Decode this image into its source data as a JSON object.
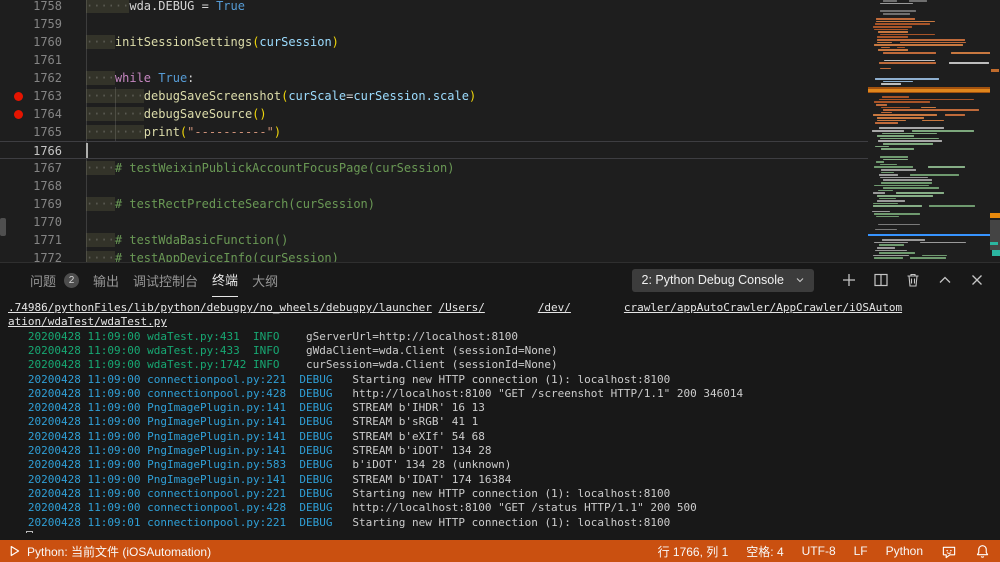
{
  "colors": {
    "statusbar_bg": "#CA5010",
    "breakpoint": "#E51400",
    "terminal_info": "#17A873",
    "terminal_debug": "#2F9FD6",
    "minimap_highlight": "#E0861C"
  },
  "editor": {
    "lines": [
      {
        "num": "1758",
        "tokens": [
          {
            "t": "······",
            "c": "ws"
          },
          {
            "t": "wda.DEBUG ",
            "c": "pl"
          },
          {
            "t": "= ",
            "c": "pl"
          },
          {
            "t": "True",
            "c": "kc"
          }
        ]
      },
      {
        "num": "1759",
        "tokens": []
      },
      {
        "num": "1760",
        "tokens": [
          {
            "t": "····",
            "c": "ws"
          },
          {
            "t": "initSessionSettings",
            "c": "fn"
          },
          {
            "t": "(",
            "c": "br"
          },
          {
            "t": "curSession",
            "c": "vr"
          },
          {
            "t": ")",
            "c": "br"
          }
        ]
      },
      {
        "num": "1761",
        "tokens": []
      },
      {
        "num": "1762",
        "tokens": [
          {
            "t": "····",
            "c": "ws"
          },
          {
            "t": "while ",
            "c": "kw"
          },
          {
            "t": "True",
            "c": "kc"
          },
          {
            "t": ":",
            "c": "pl"
          }
        ]
      },
      {
        "num": "1763",
        "bp": true,
        "g2": true,
        "tokens": [
          {
            "t": "········",
            "c": "ws"
          },
          {
            "t": "debugSaveScreenshot",
            "c": "fn"
          },
          {
            "t": "(",
            "c": "br"
          },
          {
            "t": "curScale",
            "c": "vr"
          },
          {
            "t": "=",
            "c": "pl"
          },
          {
            "t": "curSession.scale",
            "c": "vr"
          },
          {
            "t": ")",
            "c": "br"
          }
        ]
      },
      {
        "num": "1764",
        "bp": true,
        "g2": true,
        "tokens": [
          {
            "t": "········",
            "c": "ws"
          },
          {
            "t": "debugSaveSource",
            "c": "fn"
          },
          {
            "t": "()",
            "c": "br"
          }
        ]
      },
      {
        "num": "1765",
        "g2": true,
        "tokens": [
          {
            "t": "········",
            "c": "ws"
          },
          {
            "t": "print",
            "c": "fn"
          },
          {
            "t": "(",
            "c": "br"
          },
          {
            "t": "\"----------\"",
            "c": "st"
          },
          {
            "t": ")",
            "c": "br"
          }
        ]
      },
      {
        "num": "1766",
        "cur": true,
        "tokens": []
      },
      {
        "num": "1767",
        "tokens": [
          {
            "t": "····",
            "c": "ws"
          },
          {
            "t": "# testWeixinPublickAccountFocusPage(curSession)",
            "c": "cm"
          }
        ]
      },
      {
        "num": "1768",
        "tokens": []
      },
      {
        "num": "1769",
        "tokens": [
          {
            "t": "····",
            "c": "ws"
          },
          {
            "t": "# testRectPredicteSearch(curSession)",
            "c": "cm"
          }
        ]
      },
      {
        "num": "1770",
        "tokens": []
      },
      {
        "num": "1771",
        "tokens": [
          {
            "t": "····",
            "c": "ws"
          },
          {
            "t": "# testWdaBasicFunction()",
            "c": "cm"
          }
        ]
      },
      {
        "num": "1772",
        "tokens": [
          {
            "t": "····",
            "c": "ws"
          },
          {
            "t": "# testAppDeviceInfo(curSession)",
            "c": "cm"
          }
        ]
      }
    ]
  },
  "panel": {
    "tabs": [
      {
        "name": "problems",
        "label": "问题",
        "badge": "2"
      },
      {
        "name": "output",
        "label": "输出"
      },
      {
        "name": "debug-console",
        "label": "调试控制台"
      },
      {
        "name": "terminal",
        "label": "终端",
        "active": true
      },
      {
        "name": "outline",
        "label": "大纲"
      }
    ],
    "dropdown_value": "2: Python Debug Console"
  },
  "terminal": {
    "lines": [
      {
        "segs": [
          {
            "t": ".74986/pythonFiles/lib/python/debugpy/no_wheels/debugpy/launcher",
            "c": "lk"
          },
          {
            "t": " ",
            "c": "pl"
          },
          {
            "t": "/Users/",
            "c": "lk"
          },
          {
            "t": "        ",
            "c": "gap"
          },
          {
            "t": "/dev/",
            "c": "lk"
          },
          {
            "t": "        ",
            "c": "gap"
          },
          {
            "t": "crawler/appAutoCrawler/AppCrawler/iOSAutom",
            "c": "lk"
          }
        ]
      },
      {
        "segs": [
          {
            "t": "ation/wdaTest/wdaTest.py",
            "c": "lk"
          }
        ]
      },
      {
        "segs": [
          {
            "t": "   20200428 11:09:00 wdaTest.py:431  INFO",
            "c": "inf"
          },
          {
            "t": "    gServerUrl=http://localhost:8100",
            "c": "pl"
          }
        ]
      },
      {
        "segs": [
          {
            "t": "   20200428 11:09:00 wdaTest.py:433  INFO",
            "c": "inf"
          },
          {
            "t": "    gWdaClient=wda.Client (sessionId=None)",
            "c": "pl"
          }
        ]
      },
      {
        "segs": [
          {
            "t": "   20200428 11:09:00 wdaTest.py:1742 INFO",
            "c": "inf"
          },
          {
            "t": "    curSession=wda.Client (sessionId=None)",
            "c": "pl"
          }
        ]
      },
      {
        "segs": [
          {
            "t": "   20200428 11:09:00 connectionpool.py:221  DEBUG",
            "c": "dbg"
          },
          {
            "t": "   Starting new HTTP connection (1): localhost:8100",
            "c": "pl"
          }
        ]
      },
      {
        "segs": [
          {
            "t": "   20200428 11:09:00 connectionpool.py:428  DEBUG",
            "c": "dbg"
          },
          {
            "t": "   http://localhost:8100 \"GET /screenshot HTTP/1.1\" 200 346014",
            "c": "pl"
          }
        ]
      },
      {
        "segs": [
          {
            "t": "   20200428 11:09:00 PngImagePlugin.py:141  DEBUG",
            "c": "dbg"
          },
          {
            "t": "   STREAM b'IHDR' 16 13",
            "c": "pl"
          }
        ]
      },
      {
        "segs": [
          {
            "t": "   20200428 11:09:00 PngImagePlugin.py:141  DEBUG",
            "c": "dbg"
          },
          {
            "t": "   STREAM b'sRGB' 41 1",
            "c": "pl"
          }
        ]
      },
      {
        "segs": [
          {
            "t": "   20200428 11:09:00 PngImagePlugin.py:141  DEBUG",
            "c": "dbg"
          },
          {
            "t": "   STREAM b'eXIf' 54 68",
            "c": "pl"
          }
        ]
      },
      {
        "segs": [
          {
            "t": "   20200428 11:09:00 PngImagePlugin.py:141  DEBUG",
            "c": "dbg"
          },
          {
            "t": "   STREAM b'iDOT' 134 28",
            "c": "pl"
          }
        ]
      },
      {
        "segs": [
          {
            "t": "   20200428 11:09:00 PngImagePlugin.py:583  DEBUG",
            "c": "dbg"
          },
          {
            "t": "   b'iDOT' 134 28 (unknown)",
            "c": "pl"
          }
        ]
      },
      {
        "segs": [
          {
            "t": "   20200428 11:09:00 PngImagePlugin.py:141  DEBUG",
            "c": "dbg"
          },
          {
            "t": "   STREAM b'IDAT' 174 16384",
            "c": "pl"
          }
        ]
      },
      {
        "segs": [
          {
            "t": "   20200428 11:09:00 connectionpool.py:221  DEBUG",
            "c": "dbg"
          },
          {
            "t": "   Starting new HTTP connection (1): localhost:8100",
            "c": "pl"
          }
        ]
      },
      {
        "segs": [
          {
            "t": "   20200428 11:09:00 connectionpool.py:428  DEBUG",
            "c": "dbg"
          },
          {
            "t": "   http://localhost:8100 \"GET /status HTTP/1.1\" 200 500",
            "c": "pl"
          }
        ]
      },
      {
        "segs": [
          {
            "t": "   20200428 11:09:01 connectionpool.py:221  DEBUG",
            "c": "dbg"
          },
          {
            "t": "   Starting new HTTP connection (1): localhost:8100",
            "c": "pl"
          }
        ]
      }
    ]
  },
  "statusbar": {
    "left_label": "Python: 当前文件 (iOSAutomation)",
    "line_col": "行 1766, 列 1",
    "indent": "空格: 4",
    "encoding": "UTF-8",
    "eol": "LF",
    "language": "Python"
  }
}
